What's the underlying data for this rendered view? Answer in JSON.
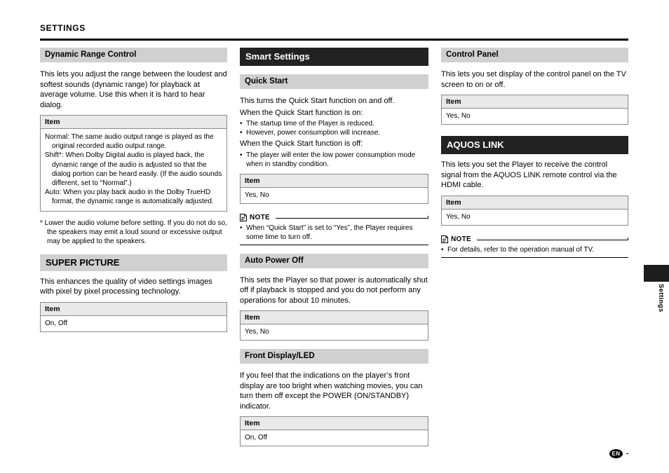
{
  "header": {
    "title": "SETTINGS"
  },
  "side_tab": {
    "label": "Settings"
  },
  "footer": {
    "lang_badge": "EN",
    "page_number": "-"
  },
  "labels": {
    "item_header": "Item",
    "note_label": "NOTE",
    "note_icon": "note-pencil-icon"
  },
  "column1": {
    "sections": [
      {
        "heading": "Dynamic Range Control",
        "heading_style": "gray",
        "body": "This lets you adjust the range between the loudest and softest sounds (dynamic range) for playback at average volume. Use this when it is hard to hear dialog.",
        "table": {
          "header": "Item",
          "rows": [
            "Normal: The same audio output range is played as the original recorded audio output range.",
            "Shift*: When Dolby Digital audio is played back, the dynamic range of the audio is adjusted so that the dialog portion can be heard easily. (If the audio sounds different, set to “Normal”.)",
            "Auto: When you play back audio in the Dolby TrueHD format, the dynamic range is automatically adjusted."
          ]
        },
        "footnote": "* Lower the audio volume before setting. If you do not do so, the speakers may emit a loud sound or excessive output may be applied to the speakers."
      },
      {
        "heading": "SUPER PICTURE",
        "heading_style": "gray-big",
        "body": "This enhances the quality of video settings images with pixel by pixel processing technology.",
        "table": {
          "header": "Item",
          "rows": [
            "On, Off"
          ]
        }
      }
    ]
  },
  "column2": {
    "sections": [
      {
        "heading": "Smart Settings",
        "heading_style": "black",
        "subsections": [
          {
            "heading": "Quick Start",
            "body": "This turns the Quick Start function on and off.",
            "line2": "When the Quick Start function is on:",
            "bullets_on": [
              "The startup time of the Player is reduced.",
              "However, power consumption will increase."
            ],
            "line3": "When the Quick Start function is off:",
            "bullets_off": [
              "The player will enter the low power consumption mode when in standby condition."
            ],
            "table": {
              "header": "Item",
              "rows": [
                "Yes, No"
              ]
            },
            "note": {
              "label": "NOTE",
              "items": [
                "When “Quick Start” is set to “Yes”, the Player requires some time to turn off."
              ]
            }
          },
          {
            "heading": "Auto Power Off",
            "body": "This sets the Player so that power is automatically shut off if playback is stopped and you do not perform any operations for about 10 minutes.",
            "table": {
              "header": "Item",
              "rows": [
                "Yes, No"
              ]
            }
          },
          {
            "heading": "Front Display/LED",
            "body": "If you feel that the indications on the player’s front display are too bright when watching movies, you can turn them off except the POWER (ON/STANDBY) indicator.",
            "table": {
              "header": "Item",
              "rows": [
                "On, Off"
              ]
            }
          }
        ]
      }
    ]
  },
  "column3": {
    "sections": [
      {
        "heading": "Control Panel",
        "heading_style": "gray",
        "body": "This lets you set display of the control panel on the TV screen to on or off.",
        "table": {
          "header": "Item",
          "rows": [
            "Yes, No"
          ]
        }
      },
      {
        "heading": "AQUOS LINK",
        "heading_style": "black",
        "body": "This lets you set the Player to receive the control signal from the AQUOS LINK remote control via the HDMI cable.",
        "table": {
          "header": "Item",
          "rows": [
            "Yes, No"
          ]
        },
        "note": {
          "label": "NOTE",
          "items": [
            "For details, refer to the operation manual of TV."
          ]
        }
      }
    ]
  }
}
